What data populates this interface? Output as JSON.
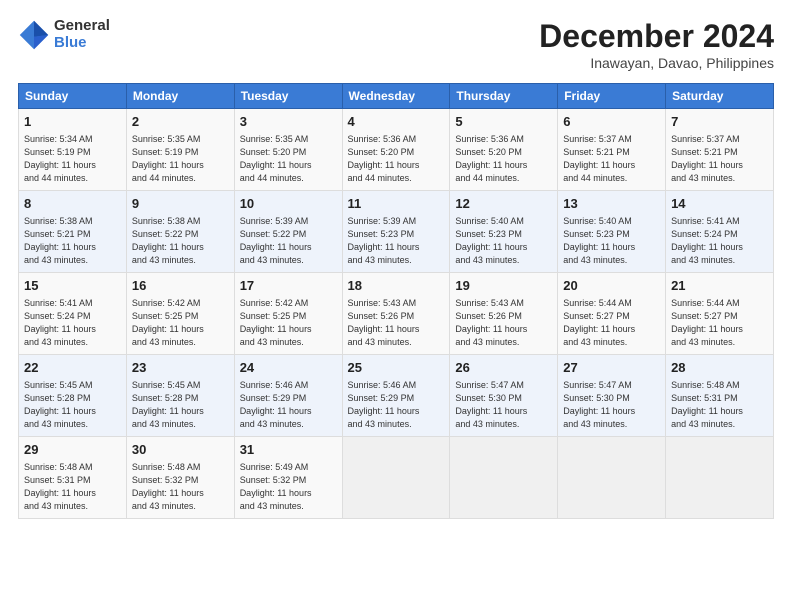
{
  "logo": {
    "general": "General",
    "blue": "Blue"
  },
  "title": "December 2024",
  "subtitle": "Inawayan, Davao, Philippines",
  "headers": [
    "Sunday",
    "Monday",
    "Tuesday",
    "Wednesday",
    "Thursday",
    "Friday",
    "Saturday"
  ],
  "weeks": [
    [
      {
        "day": "1",
        "info": "Sunrise: 5:34 AM\nSunset: 5:19 PM\nDaylight: 11 hours\nand 44 minutes."
      },
      {
        "day": "2",
        "info": "Sunrise: 5:35 AM\nSunset: 5:19 PM\nDaylight: 11 hours\nand 44 minutes."
      },
      {
        "day": "3",
        "info": "Sunrise: 5:35 AM\nSunset: 5:20 PM\nDaylight: 11 hours\nand 44 minutes."
      },
      {
        "day": "4",
        "info": "Sunrise: 5:36 AM\nSunset: 5:20 PM\nDaylight: 11 hours\nand 44 minutes."
      },
      {
        "day": "5",
        "info": "Sunrise: 5:36 AM\nSunset: 5:20 PM\nDaylight: 11 hours\nand 44 minutes."
      },
      {
        "day": "6",
        "info": "Sunrise: 5:37 AM\nSunset: 5:21 PM\nDaylight: 11 hours\nand 44 minutes."
      },
      {
        "day": "7",
        "info": "Sunrise: 5:37 AM\nSunset: 5:21 PM\nDaylight: 11 hours\nand 43 minutes."
      }
    ],
    [
      {
        "day": "8",
        "info": "Sunrise: 5:38 AM\nSunset: 5:21 PM\nDaylight: 11 hours\nand 43 minutes."
      },
      {
        "day": "9",
        "info": "Sunrise: 5:38 AM\nSunset: 5:22 PM\nDaylight: 11 hours\nand 43 minutes."
      },
      {
        "day": "10",
        "info": "Sunrise: 5:39 AM\nSunset: 5:22 PM\nDaylight: 11 hours\nand 43 minutes."
      },
      {
        "day": "11",
        "info": "Sunrise: 5:39 AM\nSunset: 5:23 PM\nDaylight: 11 hours\nand 43 minutes."
      },
      {
        "day": "12",
        "info": "Sunrise: 5:40 AM\nSunset: 5:23 PM\nDaylight: 11 hours\nand 43 minutes."
      },
      {
        "day": "13",
        "info": "Sunrise: 5:40 AM\nSunset: 5:23 PM\nDaylight: 11 hours\nand 43 minutes."
      },
      {
        "day": "14",
        "info": "Sunrise: 5:41 AM\nSunset: 5:24 PM\nDaylight: 11 hours\nand 43 minutes."
      }
    ],
    [
      {
        "day": "15",
        "info": "Sunrise: 5:41 AM\nSunset: 5:24 PM\nDaylight: 11 hours\nand 43 minutes."
      },
      {
        "day": "16",
        "info": "Sunrise: 5:42 AM\nSunset: 5:25 PM\nDaylight: 11 hours\nand 43 minutes."
      },
      {
        "day": "17",
        "info": "Sunrise: 5:42 AM\nSunset: 5:25 PM\nDaylight: 11 hours\nand 43 minutes."
      },
      {
        "day": "18",
        "info": "Sunrise: 5:43 AM\nSunset: 5:26 PM\nDaylight: 11 hours\nand 43 minutes."
      },
      {
        "day": "19",
        "info": "Sunrise: 5:43 AM\nSunset: 5:26 PM\nDaylight: 11 hours\nand 43 minutes."
      },
      {
        "day": "20",
        "info": "Sunrise: 5:44 AM\nSunset: 5:27 PM\nDaylight: 11 hours\nand 43 minutes."
      },
      {
        "day": "21",
        "info": "Sunrise: 5:44 AM\nSunset: 5:27 PM\nDaylight: 11 hours\nand 43 minutes."
      }
    ],
    [
      {
        "day": "22",
        "info": "Sunrise: 5:45 AM\nSunset: 5:28 PM\nDaylight: 11 hours\nand 43 minutes."
      },
      {
        "day": "23",
        "info": "Sunrise: 5:45 AM\nSunset: 5:28 PM\nDaylight: 11 hours\nand 43 minutes."
      },
      {
        "day": "24",
        "info": "Sunrise: 5:46 AM\nSunset: 5:29 PM\nDaylight: 11 hours\nand 43 minutes."
      },
      {
        "day": "25",
        "info": "Sunrise: 5:46 AM\nSunset: 5:29 PM\nDaylight: 11 hours\nand 43 minutes."
      },
      {
        "day": "26",
        "info": "Sunrise: 5:47 AM\nSunset: 5:30 PM\nDaylight: 11 hours\nand 43 minutes."
      },
      {
        "day": "27",
        "info": "Sunrise: 5:47 AM\nSunset: 5:30 PM\nDaylight: 11 hours\nand 43 minutes."
      },
      {
        "day": "28",
        "info": "Sunrise: 5:48 AM\nSunset: 5:31 PM\nDaylight: 11 hours\nand 43 minutes."
      }
    ],
    [
      {
        "day": "29",
        "info": "Sunrise: 5:48 AM\nSunset: 5:31 PM\nDaylight: 11 hours\nand 43 minutes."
      },
      {
        "day": "30",
        "info": "Sunrise: 5:48 AM\nSunset: 5:32 PM\nDaylight: 11 hours\nand 43 minutes."
      },
      {
        "day": "31",
        "info": "Sunrise: 5:49 AM\nSunset: 5:32 PM\nDaylight: 11 hours\nand 43 minutes."
      },
      {
        "day": "",
        "info": ""
      },
      {
        "day": "",
        "info": ""
      },
      {
        "day": "",
        "info": ""
      },
      {
        "day": "",
        "info": ""
      }
    ]
  ]
}
